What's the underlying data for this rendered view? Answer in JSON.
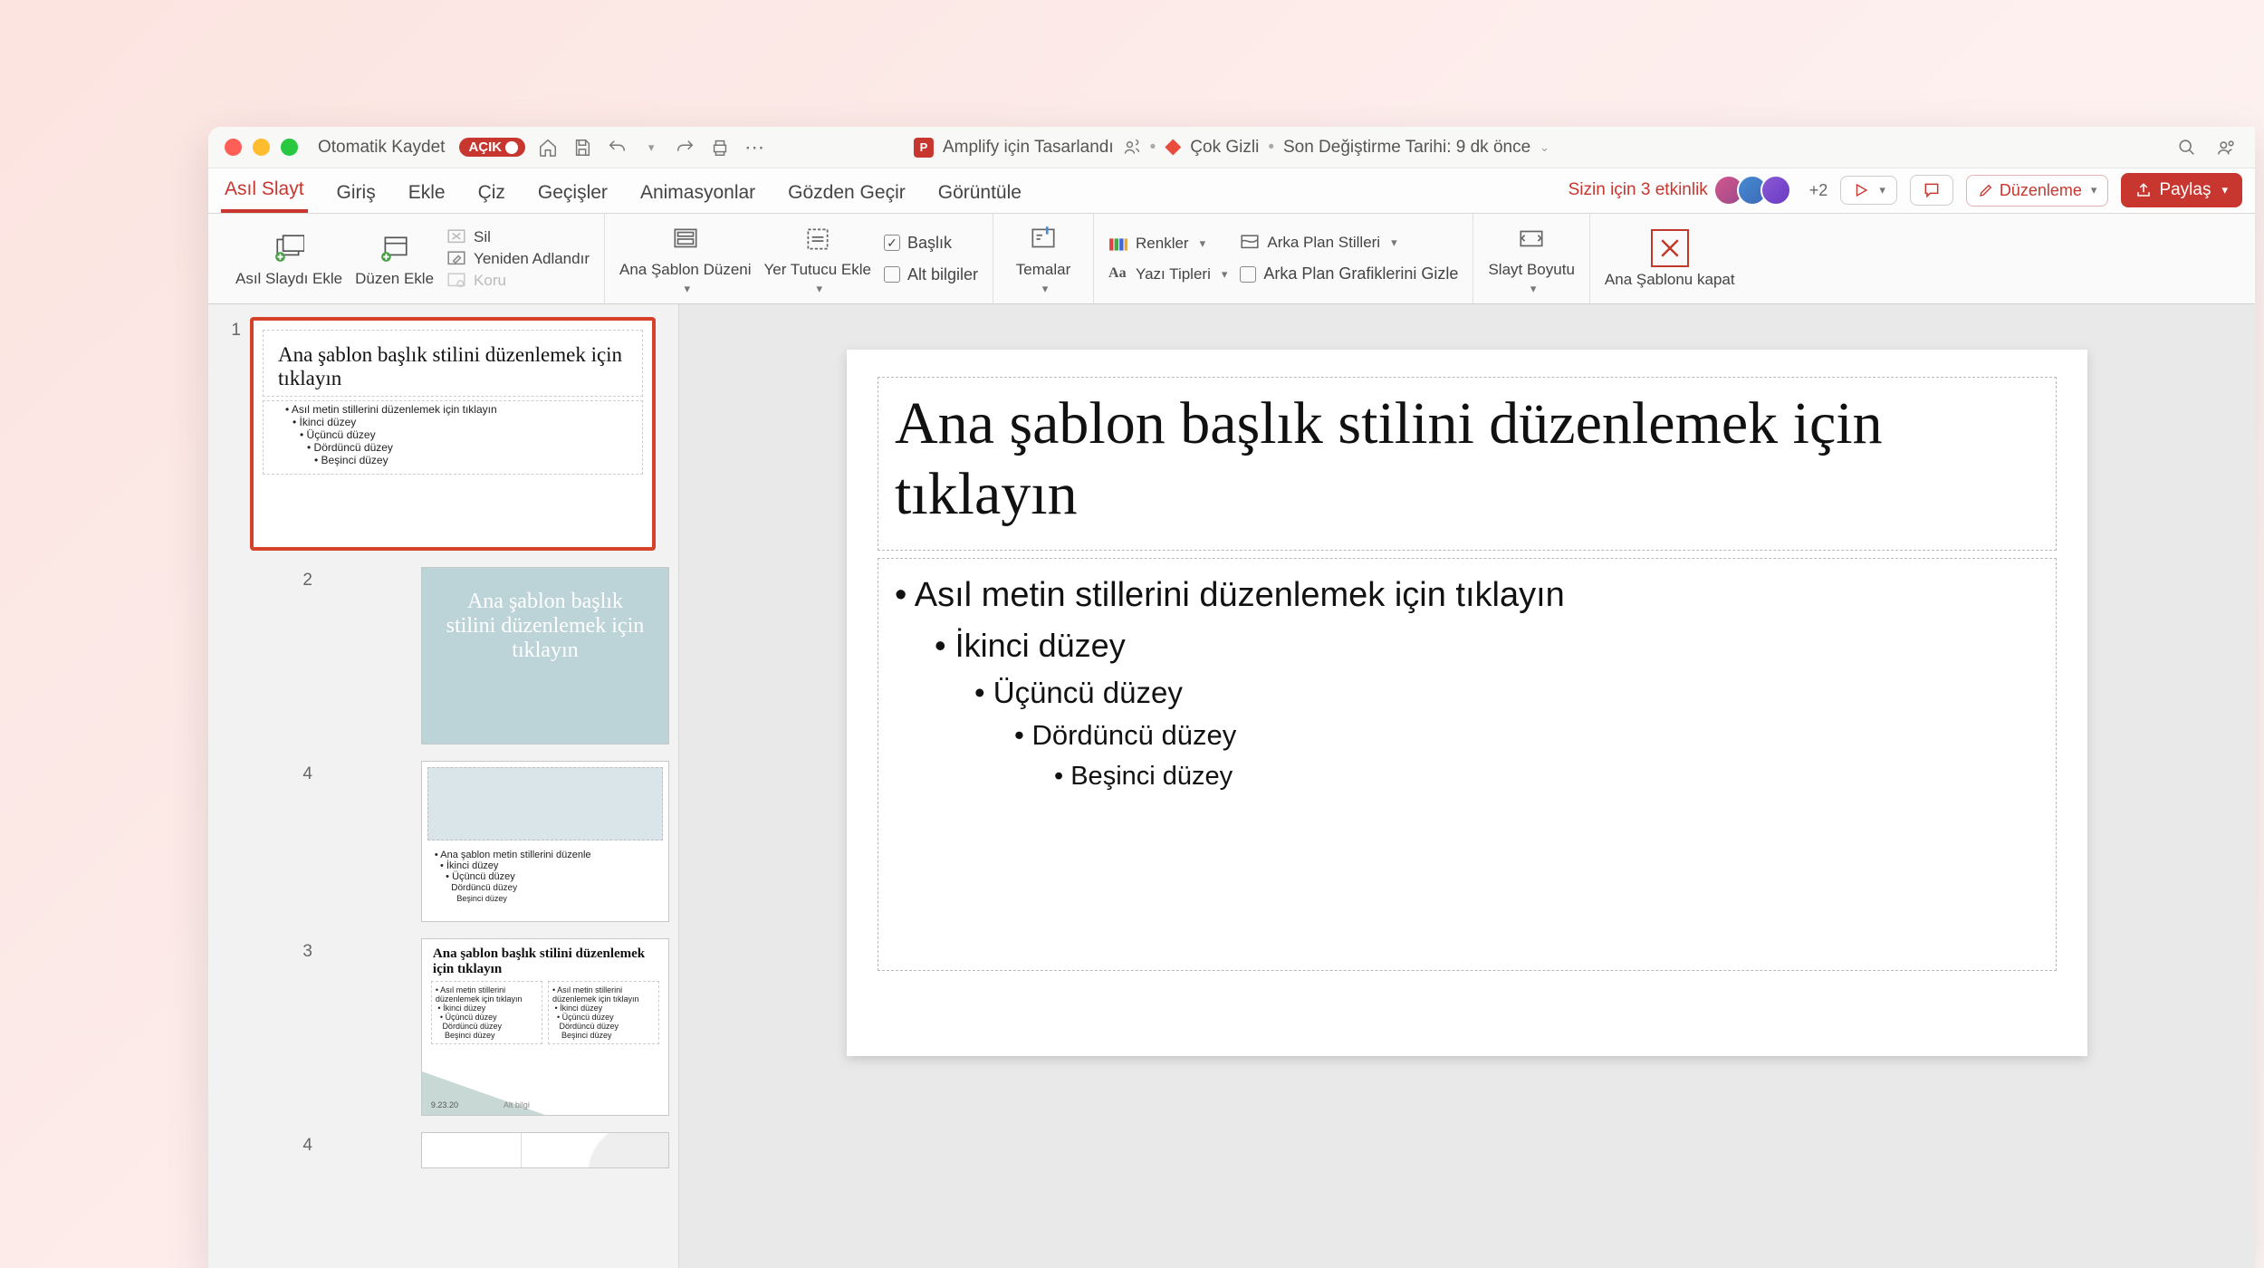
{
  "titlebar": {
    "autosave_label": "Otomatik Kaydet",
    "autosave_state": "AÇIK",
    "doc_name": "Amplify için Tasarlandı",
    "sensitivity": "Çok Gizli",
    "last_modified": "Son Değiştirme Tarihi: 9 dk önce"
  },
  "tabs": {
    "items": [
      "Asıl Slayt",
      "Giriş",
      "Ekle",
      "Çiz",
      "Geçişler",
      "Animasyonlar",
      "Gözden Geçir",
      "Görüntüle"
    ],
    "activity_text": "Sizin için 3 etkinlik",
    "plus_count": "+2",
    "edit_label": "Düzenleme",
    "share_label": "Paylaş"
  },
  "ribbon": {
    "insert_master": "Asıl Slaydı Ekle",
    "insert_layout": "Düzen Ekle",
    "delete": "Sil",
    "rename": "Yeniden Adlandır",
    "preserve": "Koru",
    "master_layout": "Ana Şablon Düzeni",
    "insert_placeholder": "Yer Tutucu Ekle",
    "title_chk": "Başlık",
    "footers_chk": "Alt bilgiler",
    "themes": "Temalar",
    "colors": "Renkler",
    "fonts": "Yazı Tipleri",
    "bg_styles": "Arka Plan Stilleri",
    "hide_bg": "Arka Plan Grafiklerini Gizle",
    "slide_size": "Slayt Boyutu",
    "close_master": "Ana Şablonu kapat"
  },
  "thumbnails": {
    "master_num": "1",
    "master_title": "Ana şablon başlık stilini düzenlemek için tıklayın",
    "master_b1": "Asıl metin stillerini düzenlemek için tıklayın",
    "master_b2": "İkinci düzey",
    "master_b3": "Üçüncü düzey",
    "master_b4": "Dördüncü düzey",
    "master_b5": "Beşinci düzey",
    "n2": "2",
    "sub2_title": "Ana şablon başlık stilini düzenlemek için tıklayın",
    "n4a": "4",
    "sub4a_b": "Ana şablon metin stillerini düzenle",
    "sub4a_b2": "İkinci düzey",
    "sub4a_b3": "Üçüncü düzey",
    "sub4a_b4": "Dördüncü düzey",
    "sub4a_b5": "Beşinci düzey",
    "n3": "3",
    "sub3_title": "Ana şablon başlık stilini düzenlemek için tıklayın",
    "sub3_col": "Asıl metin stillerini düzenlemek için tıklayın",
    "sub3_date": "9.23.20",
    "sub3_footer": "Alt bilgi",
    "n4b": "4"
  },
  "slide": {
    "title": "Ana şablon başlık stilini düzenlemek için tıklayın",
    "b1": "Asıl metin stillerini düzenlemek için tıklayın",
    "b2": "İkinci düzey",
    "b3": "Üçüncü düzey",
    "b4": "Dördüncü düzey",
    "b5": "Beşinci düzey"
  }
}
